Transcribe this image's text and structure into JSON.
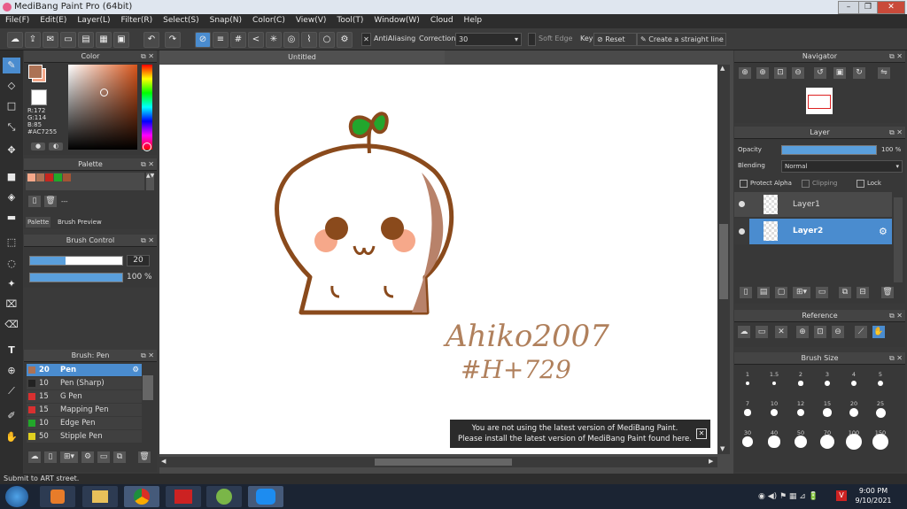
{
  "window": {
    "title": "MediBang Paint Pro (64bit)"
  },
  "menu": [
    "File(F)",
    "Edit(E)",
    "Layer(L)",
    "Filter(R)",
    "Select(S)",
    "Snap(N)",
    "Color(C)",
    "View(V)",
    "Tool(T)",
    "Window(W)",
    "Cloud",
    "Help"
  ],
  "toolbar": {
    "antialiasing_label": "AntiAliasing",
    "correction_label": "Correction",
    "correction_value": "30",
    "soft_edge_label": "Soft Edge",
    "key_label": "Key",
    "reset_label": "Reset",
    "straight_line_label": "Create a straight line"
  },
  "color_panel": {
    "title": "Color",
    "r": "R:172",
    "g": "G:114",
    "b": "B:85",
    "hex": "#AC7255",
    "primary_color": "#AC7255",
    "secondary_color": "#F6A88A"
  },
  "palette_panel": {
    "title": "Palette",
    "swatches": [
      "#F6A88A",
      "#AC7255",
      "#C6261E",
      "#22A72A",
      "#A35435"
    ],
    "name_value": "---",
    "tab_palette": "Palette",
    "tab_brush_preview": "Brush Preview"
  },
  "brush_control": {
    "title": "Brush Control",
    "size_value": "20",
    "size_fraction": 0.38,
    "opacity_value": "100 %",
    "opacity_fraction": 1.0
  },
  "brush_panel": {
    "title": "Brush: Pen",
    "brushes": [
      {
        "size": "20",
        "name": "Pen",
        "color": "#AC7255",
        "selected": true
      },
      {
        "size": "10",
        "name": "Pen (Sharp)",
        "color": "#222222",
        "selected": false
      },
      {
        "size": "15",
        "name": "G Pen",
        "color": "#d83030",
        "selected": false
      },
      {
        "size": "15",
        "name": "Mapping Pen",
        "color": "#d83030",
        "selected": false
      },
      {
        "size": "10",
        "name": "Edge Pen",
        "color": "#22a72a",
        "selected": false
      },
      {
        "size": "50",
        "name": "Stipple Pen",
        "color": "#e0d020",
        "selected": false
      }
    ]
  },
  "canvas": {
    "tab_title": "Untitled",
    "signature_line1": "Ahiko2007",
    "signature_line2": "#H+729",
    "notice_line1": "You are not using the latest version of MediBang Paint.",
    "notice_line2": "Please install the latest version of MediBang Paint found here."
  },
  "navigator": {
    "title": "Navigator"
  },
  "layer_panel": {
    "title": "Layer",
    "opacity_label": "Opacity",
    "opacity_value": "100 %",
    "opacity_fraction": 1.0,
    "blending_label": "Blending",
    "blending_value": "Normal",
    "protect_alpha_label": "Protect Alpha",
    "clipping_label": "Clipping",
    "lock_label": "Lock",
    "layers": [
      {
        "name": "Layer1",
        "selected": false
      },
      {
        "name": "Layer2",
        "selected": true
      }
    ]
  },
  "reference": {
    "title": "Reference"
  },
  "brush_size": {
    "title": "Brush Size",
    "sizes": [
      "1",
      "1.5",
      "2",
      "3",
      "4",
      "5",
      "7",
      "10",
      "12",
      "15",
      "20",
      "25",
      "30",
      "40",
      "50",
      "70",
      "100",
      "150"
    ]
  },
  "status_bar": {
    "text": "Submit to ART street."
  },
  "taskbar": {
    "time": "9:00 PM",
    "date": "9/10/2021"
  }
}
